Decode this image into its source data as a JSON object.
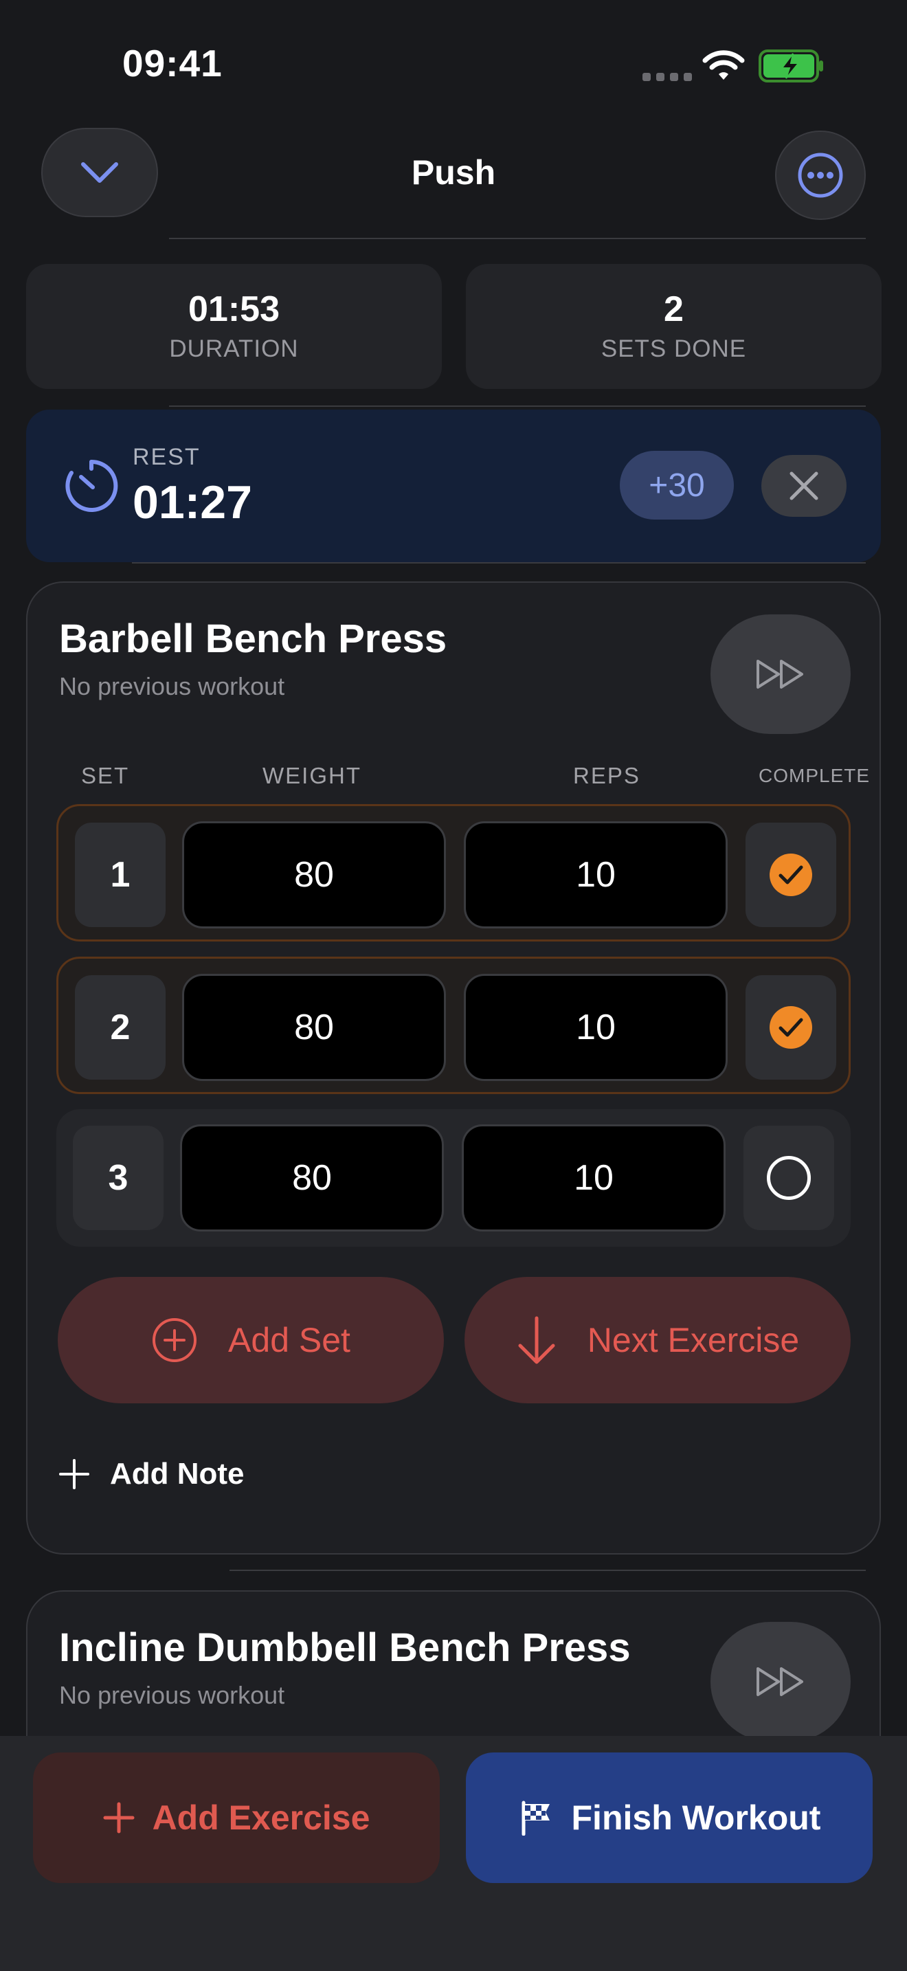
{
  "status_bar": {
    "time": "09:41"
  },
  "header": {
    "title": "Push"
  },
  "stats": [
    {
      "value": "01:53",
      "label": "DURATION"
    },
    {
      "value": "2",
      "label": "SETS DONE"
    }
  ],
  "rest": {
    "label": "REST",
    "time": "01:27",
    "add_label": "+30"
  },
  "exercises": [
    {
      "name": "Barbell Bench Press",
      "subtitle": "No previous workout",
      "columns": {
        "set": "SET",
        "weight": "WEIGHT",
        "reps": "REPS",
        "complete": "COMPLETE"
      },
      "sets": [
        {
          "set": "1",
          "weight": "80",
          "reps": "10",
          "complete": true
        },
        {
          "set": "2",
          "weight": "80",
          "reps": "10",
          "complete": true
        },
        {
          "set": "3",
          "weight": "80",
          "reps": "10",
          "complete": false
        }
      ],
      "add_set_label": "Add Set",
      "next_exercise_label": "Next Exercise",
      "add_note_label": "Add Note"
    },
    {
      "name": "Incline Dumbbell Bench Press",
      "subtitle": "No previous workout"
    }
  ],
  "bottom": {
    "add_exercise_label": "Add Exercise",
    "finish_label": "Finish Workout"
  },
  "colors": {
    "accent_orange": "#f08a27",
    "accent_red": "#e45a52",
    "accent_blue": "#8fa6ee",
    "finish_blue": "#253f87"
  }
}
